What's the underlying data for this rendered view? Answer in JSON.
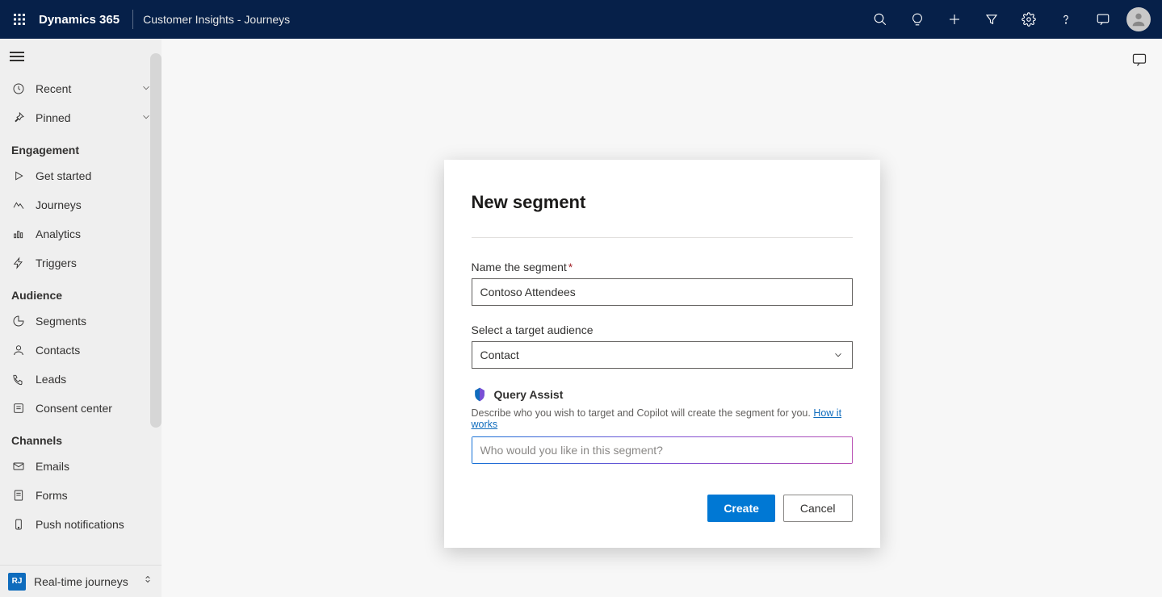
{
  "topbar": {
    "brand": "Dynamics 365",
    "subtitle": "Customer Insights - Journeys"
  },
  "sidebar": {
    "collapse": [
      {
        "label": "Recent",
        "icon": "clock"
      },
      {
        "label": "Pinned",
        "icon": "pin"
      }
    ],
    "sections": [
      {
        "title": "Engagement",
        "items": [
          {
            "label": "Get started",
            "icon": "play"
          },
          {
            "label": "Journeys",
            "icon": "journeys"
          },
          {
            "label": "Analytics",
            "icon": "analytics"
          },
          {
            "label": "Triggers",
            "icon": "triggers"
          }
        ]
      },
      {
        "title": "Audience",
        "items": [
          {
            "label": "Segments",
            "icon": "segments"
          },
          {
            "label": "Contacts",
            "icon": "contacts"
          },
          {
            "label": "Leads",
            "icon": "leads"
          },
          {
            "label": "Consent center",
            "icon": "consent"
          }
        ]
      },
      {
        "title": "Channels",
        "items": [
          {
            "label": "Emails",
            "icon": "emails"
          },
          {
            "label": "Forms",
            "icon": "forms"
          },
          {
            "label": "Push notifications",
            "icon": "push"
          }
        ]
      }
    ],
    "footer": {
      "badge": "RJ",
      "label": "Real-time journeys"
    }
  },
  "dialog": {
    "title": "New segment",
    "name_label": "Name the segment",
    "name_value": "Contoso Attendees",
    "audience_label": "Select a target audience",
    "audience_value": "Contact",
    "qa_title": "Query Assist",
    "qa_desc": "Describe who you wish to target and Copilot will create the segment for you. ",
    "qa_link": "How it works",
    "qa_placeholder": "Who would you like in this segment?",
    "create": "Create",
    "cancel": "Cancel"
  }
}
